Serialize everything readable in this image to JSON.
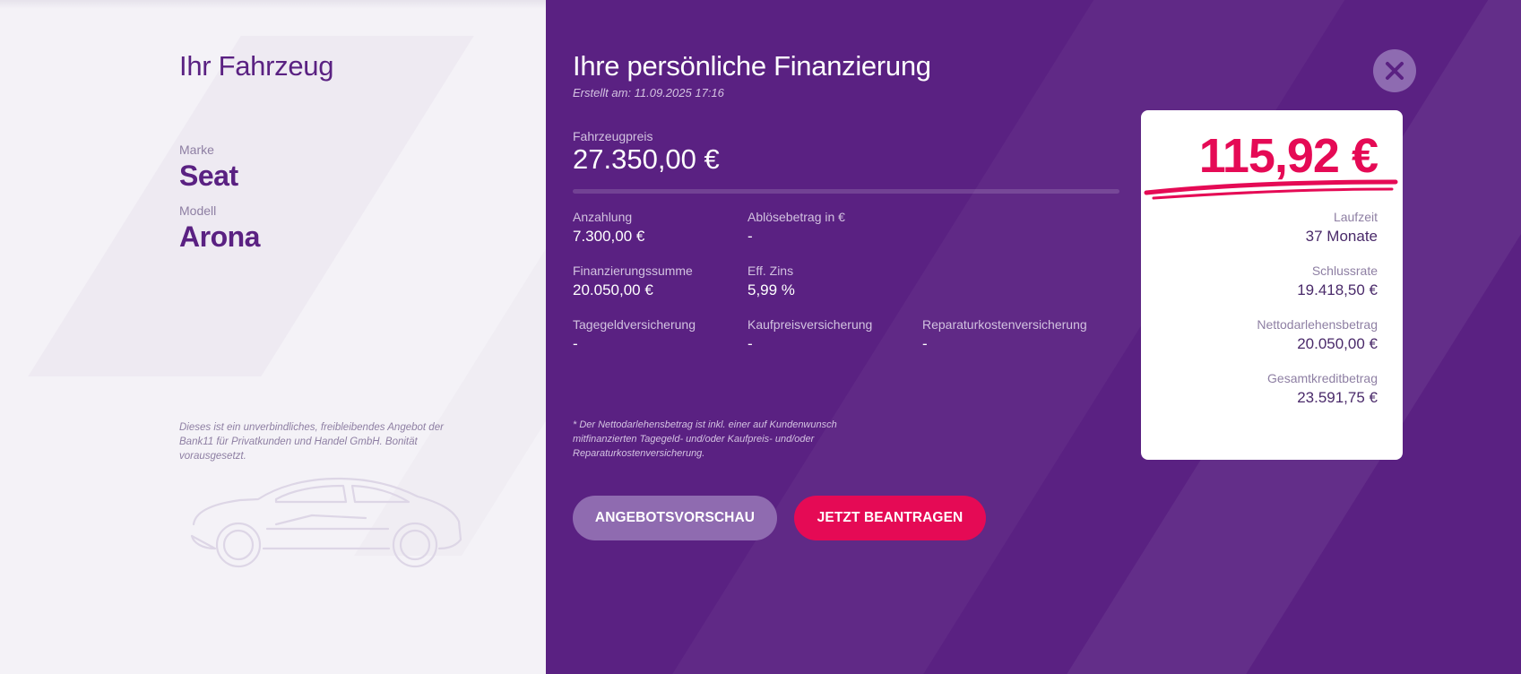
{
  "vehicle": {
    "title": "Ihr Fahrzeug",
    "brand_label": "Marke",
    "brand_value": "Seat",
    "model_label": "Modell",
    "model_value": "Arona",
    "disclaimer": "Dieses ist ein unverbindliches, freibleibendes Angebot der Bank11 für Privatkunden und Handel GmbH. Bonität vorausgesetzt."
  },
  "financing": {
    "title": "Ihre persönliche Finanzierung",
    "created": "Erstellt am: 11.09.2025 17:16",
    "price_label": "Fahrzeugpreis",
    "price_value": "27.350,00 €",
    "fields": {
      "down_payment_label": "Anzahlung",
      "down_payment_value": "7.300,00 €",
      "payoff_label": "Ablösebetrag in €",
      "payoff_value": "-",
      "sum_label": "Finanzierungssumme",
      "sum_value": "20.050,00 €",
      "interest_label": "Eff. Zins",
      "interest_value": "5,99 %",
      "daily_ins_label": "Tagegeldversicherung",
      "daily_ins_value": "-",
      "purchase_ins_label": "Kaufpreisversicherung",
      "purchase_ins_value": "-",
      "repair_ins_label": "Reparaturkostenversicherung",
      "repair_ins_value": "-"
    },
    "footnote": "* Der Nettodarlehensbetrag ist inkl. einer auf Kundenwunsch mitfinanzierten Tagegeld- und/oder Kaufpreis- und/oder Reparaturkostenversicherung.",
    "preview_button": "ANGEBOTSVORSCHAU",
    "apply_button": "JETZT BEANTRAGEN"
  },
  "card": {
    "rate": "115,92 €",
    "term_label": "Laufzeit",
    "term_value": "37 Monate",
    "final_label": "Schlussrate",
    "final_value": "19.418,50 €",
    "net_label": "Nettodarlehensbetrag",
    "net_value": "20.050,00 €",
    "total_label": "Gesamtkreditbetrag",
    "total_value": "23.591,75 €"
  },
  "colors": {
    "brand_purple": "#5a2182",
    "accent_pink": "#e50a55",
    "left_bg": "#f4f2f7"
  },
  "icons": {
    "close": "close-icon",
    "car": "car-outline-icon"
  }
}
